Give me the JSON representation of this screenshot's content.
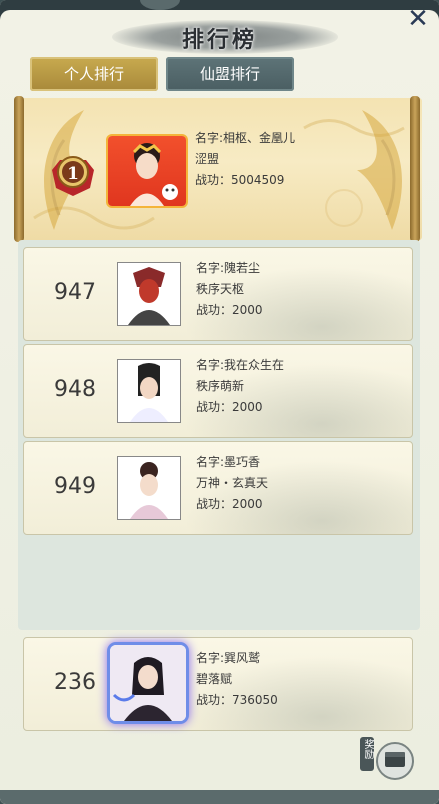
{
  "header": {
    "title": "排行榜",
    "close_glyph": "✕"
  },
  "tabs": [
    {
      "label": "个人排行",
      "active": true
    },
    {
      "label": "仙盟排行",
      "active": false
    }
  ],
  "first_place": {
    "rank": "1",
    "name": "名字:相枢、金凰儿",
    "alliance": "涩盟",
    "power": "战功：5004509"
  },
  "entries": [
    {
      "rank": "947",
      "name": "名字:隗若尘",
      "alliance": "秩序天枢",
      "power": "战功：2000"
    },
    {
      "rank": "948",
      "name": "名字:我在众生在",
      "alliance": "秩序萌新",
      "power": "战功：2000"
    },
    {
      "rank": "949",
      "name": "名字:墨巧香",
      "alliance": "万神・玄真天",
      "power": "战功：2000"
    }
  ],
  "my_entry": {
    "rank": "236",
    "name": "名字:巽风鹫",
    "alliance": "碧落赋",
    "power": "战功：736050"
  },
  "reward_button": {
    "label": "奖励"
  },
  "colors": {
    "accent_gold": "#c8aa4f",
    "inactive_tab": "#5e7478",
    "card_bg": "#faf7e6"
  }
}
